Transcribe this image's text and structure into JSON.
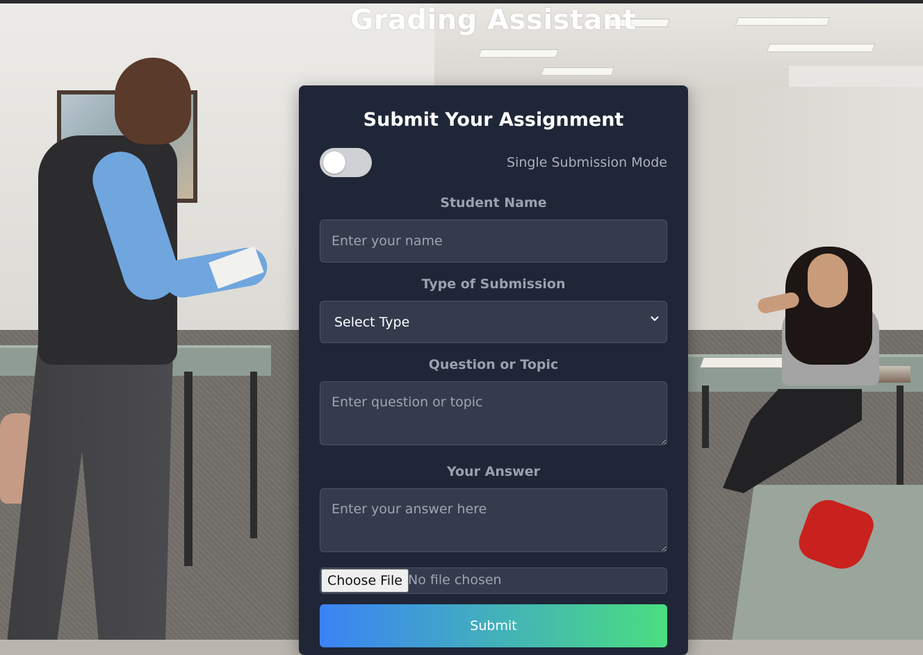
{
  "app": {
    "title": "Grading Assistant"
  },
  "form": {
    "title": "Submit Your Assignment",
    "mode_toggle": {
      "label": "Single Submission Mode",
      "on": false
    },
    "student_name": {
      "label": "Student Name",
      "placeholder": "Enter your name",
      "value": ""
    },
    "submission_type": {
      "label": "Type of Submission",
      "selected": "Select Type"
    },
    "question": {
      "label": "Question or Topic",
      "placeholder": "Enter question or topic",
      "value": ""
    },
    "answer": {
      "label": "Your Answer",
      "placeholder": "Enter your answer here",
      "value": ""
    },
    "file": {
      "button_label": "Choose File",
      "status": "No file chosen"
    },
    "submit_label": "Submit"
  },
  "colors": {
    "card_bg": "#1f2637",
    "field_bg": "#333b4d",
    "submit_gradient_start": "#3b82f6",
    "submit_gradient_end": "#4ade80"
  },
  "icons": {
    "select_chevron": "chevron-down-icon"
  }
}
